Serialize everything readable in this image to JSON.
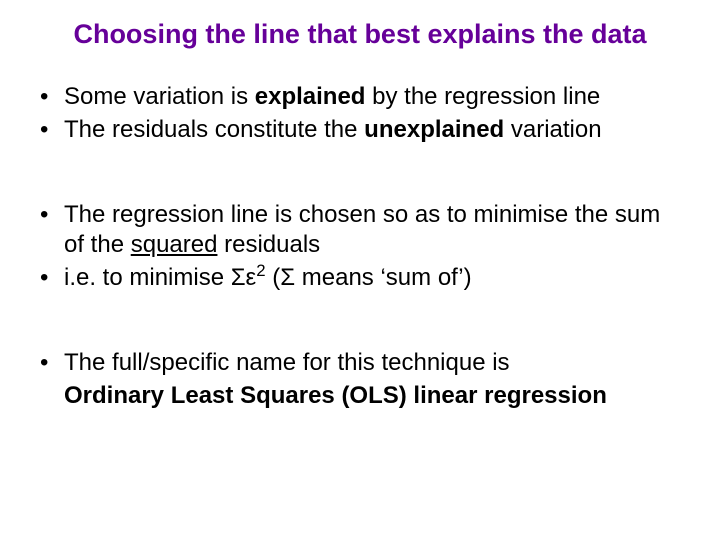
{
  "slide": {
    "title": "Choosing the line that best explains the data",
    "bullets": {
      "b1_pre": "Some variation is ",
      "b1_bold": "explained",
      "b1_post": " by the regression line",
      "b2_pre": "The residuals constitute the ",
      "b2_bold": "unexplained",
      "b2_post": " variation",
      "b3_pre": "The regression line is chosen so as to minimise the sum of the ",
      "b3_u": "squared",
      "b3_post": " residuals",
      "b4_pre": "i.e. to minimise  ",
      "b4_sigma": "Σε",
      "b4_sup": "2",
      "b4_post": " (Σ means ‘sum of’)",
      "b5": "The full/specific name for this technique is",
      "b5c": "Ordinary Least Squares (OLS) linear regression"
    }
  }
}
